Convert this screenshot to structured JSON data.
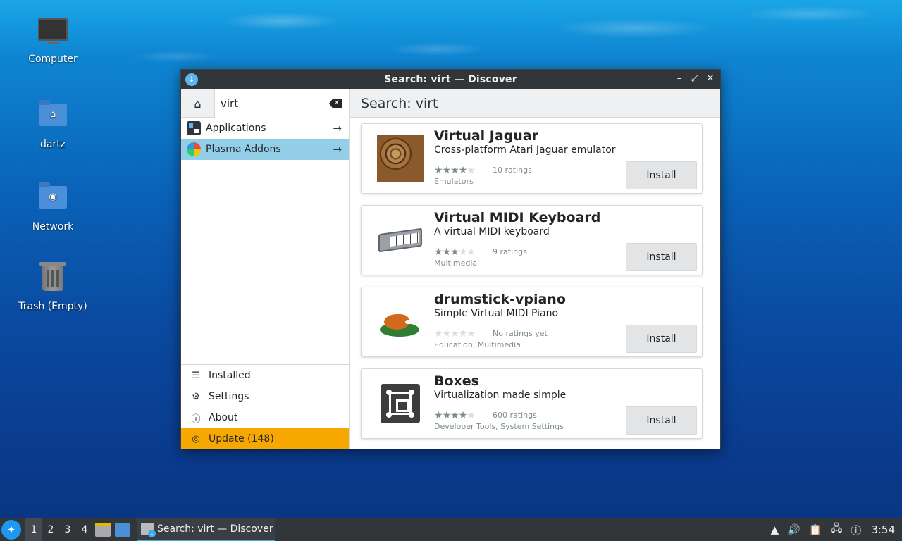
{
  "desktop": {
    "icons": [
      {
        "label": "Computer"
      },
      {
        "label": "dartz"
      },
      {
        "label": "Network"
      },
      {
        "label": "Trash (Empty)"
      }
    ]
  },
  "window": {
    "title": "Search: virt — Discover",
    "controls": {
      "minimize": "–",
      "maximize": "⤢",
      "close": "✕"
    }
  },
  "sidebar": {
    "search_value": "virt",
    "categories": [
      {
        "label": "Applications",
        "icon": "applications-icon"
      },
      {
        "label": "Plasma Addons",
        "icon": "plasma-addons-icon",
        "selected": true
      }
    ],
    "nav": [
      {
        "label": "Installed",
        "icon": "list-icon"
      },
      {
        "label": "Settings",
        "icon": "gear-icon"
      },
      {
        "label": "About",
        "icon": "info-icon"
      },
      {
        "label": "Update (148)",
        "icon": "update-icon",
        "highlight": "#f6a800"
      }
    ]
  },
  "main": {
    "header": "Search: virt",
    "results": [
      {
        "name": "Virtual Jaguar",
        "description": "Cross-platform Atari Jaguar emulator",
        "stars": 4,
        "ratings": "10 ratings",
        "categories": "Emulators",
        "action": "Install"
      },
      {
        "name": "Virtual MIDI Keyboard",
        "description": "A virtual MIDI keyboard",
        "stars": 3,
        "ratings": "9 ratings",
        "categories": "Multimedia",
        "action": "Install"
      },
      {
        "name": "drumstick-vpiano",
        "description": "Simple Virtual MIDI Piano",
        "stars": 0,
        "ratings": "No ratings yet",
        "categories": "Education, Multimedia",
        "action": "Install"
      },
      {
        "name": "Boxes",
        "description": "Virtualization made simple",
        "stars": 4,
        "ratings": "600 ratings",
        "categories": "Developer Tools, System Settings",
        "action": "Install"
      }
    ]
  },
  "taskbar": {
    "desktops": [
      "1",
      "2",
      "3",
      "4"
    ],
    "active_desktop": "1",
    "task_label": "Search: virt — Discover",
    "clock": "3:54"
  },
  "colors": {
    "accent": "#3daee9",
    "selection": "#93cee9",
    "update": "#f6a800",
    "titlebar": "#31363b"
  }
}
